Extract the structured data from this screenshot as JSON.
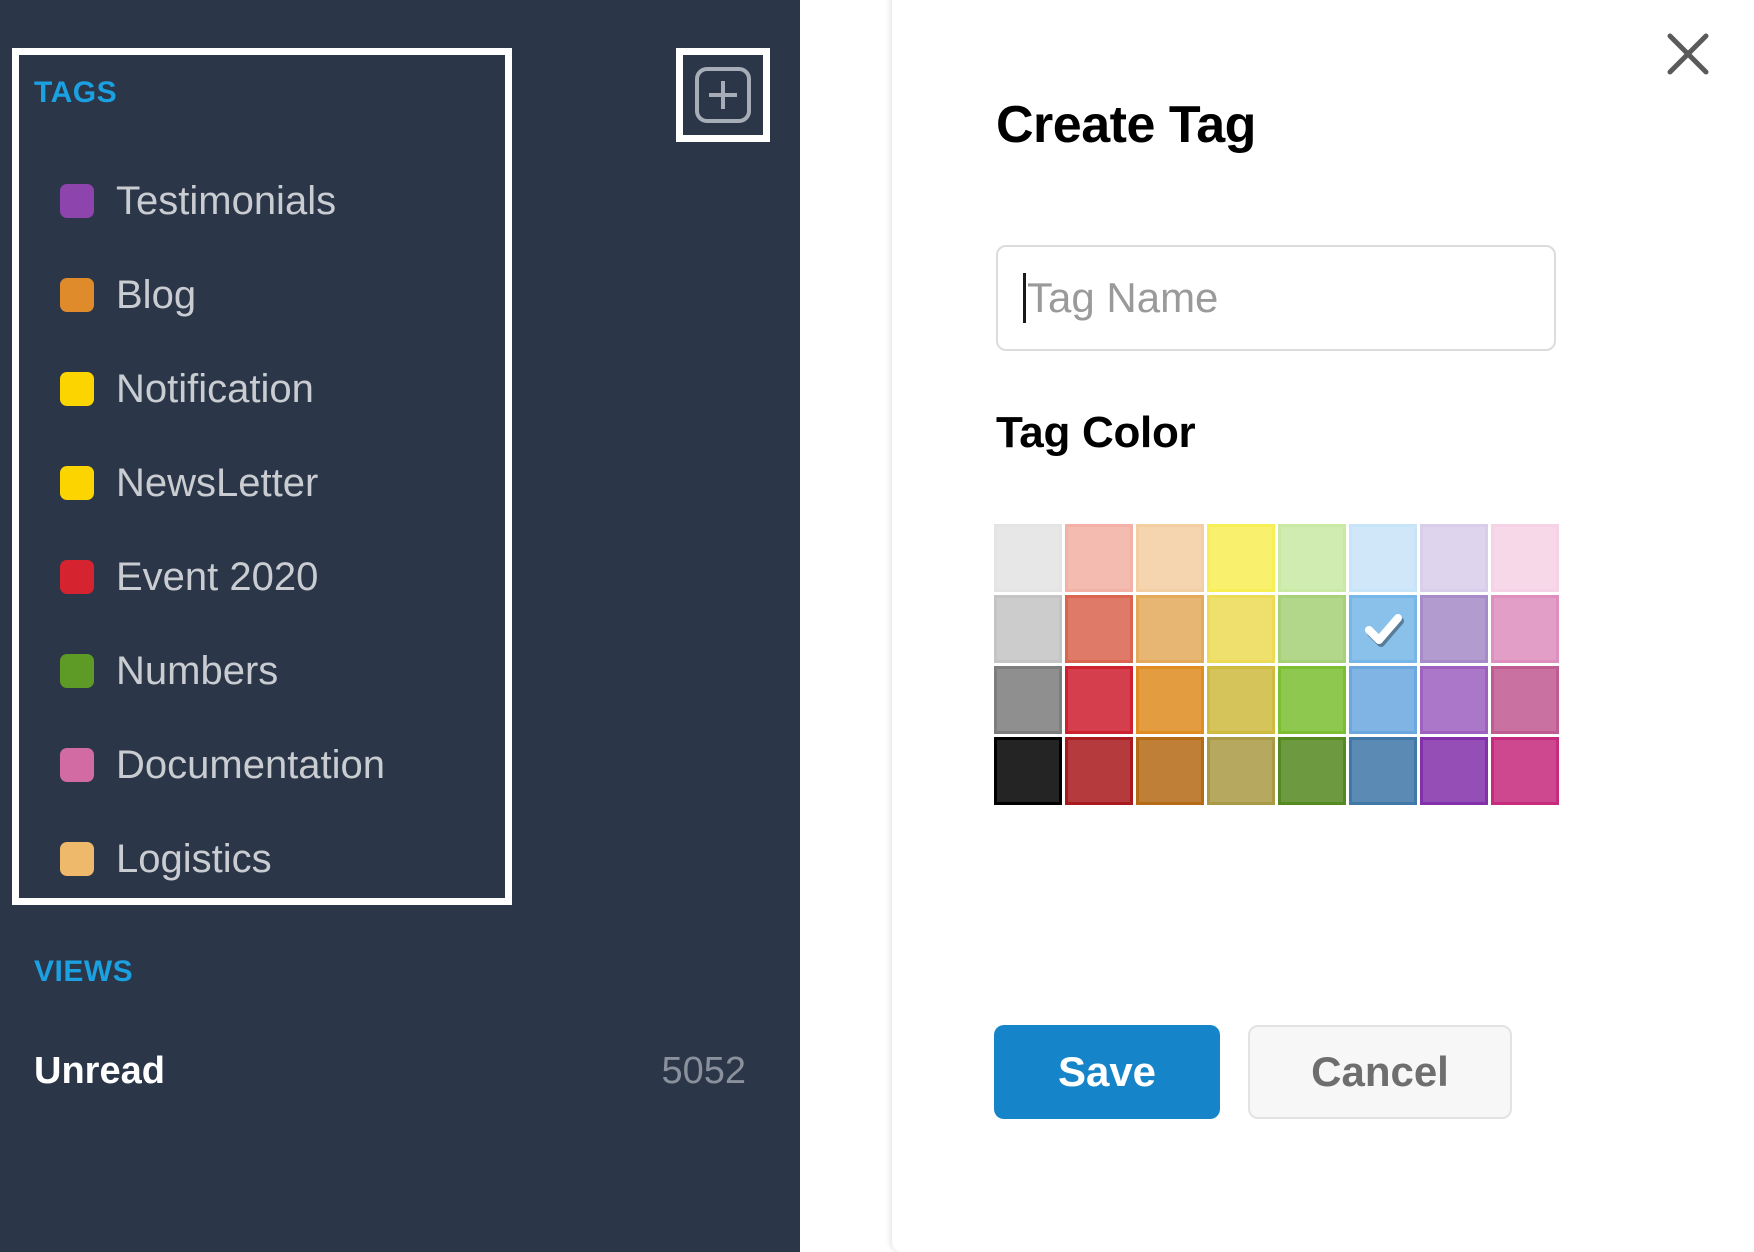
{
  "sidebar": {
    "tags_section": {
      "label": "TAGS",
      "add_button_icon": "plus-square-icon",
      "items": [
        {
          "label": "Testimonials",
          "color": "#8e44ad"
        },
        {
          "label": "Blog",
          "color": "#e08b2b"
        },
        {
          "label": "Notification",
          "color": "#fcd500"
        },
        {
          "label": "NewsLetter",
          "color": "#fcd500"
        },
        {
          "label": "Event 2020",
          "color": "#d52330"
        },
        {
          "label": "Numbers",
          "color": "#5d9b26"
        },
        {
          "label": "Documentation",
          "color": "#d26ba4"
        },
        {
          "label": "Logistics",
          "color": "#efb96b"
        }
      ]
    },
    "views_section": {
      "label": "VIEWS",
      "items": [
        {
          "name": "Unread",
          "count": "5052"
        }
      ]
    },
    "accent_color": "#1ba0e1",
    "background_color": "#2b3648"
  },
  "modal": {
    "title": "Create Tag",
    "close_icon": "close-icon",
    "tag_name": {
      "value": "",
      "placeholder": "Tag Name"
    },
    "color_label": "Tag Color",
    "selected_color": "#76b7e8",
    "selected_index": 13,
    "colors": [
      "#e4e4e4",
      "#f3b0a5",
      "#f3ceA2",
      "#f8ef55",
      "#c9e9a4",
      "#c7e4f8",
      "#d9cdec",
      "#f6d2e6",
      "#c4c4c4",
      "#da6551",
      "#e3aa5c",
      "#edda55",
      "#a6d178",
      "#76b7e8",
      "#a68bc8",
      "#de8fbd",
      "#7d7d7d",
      "#cf2030",
      "#e08c22",
      "#cfbb3e",
      "#7dbf33",
      "#6ba8e0",
      "#9e61c0",
      "#c05b92",
      "#000000",
      "#a91a1f",
      "#b56a16",
      "#ab9a45",
      "#558a21",
      "#4078a8",
      "#8331ab",
      "#c62b7e"
    ],
    "check_icon": "check-icon",
    "save_label": "Save",
    "cancel_label": "Cancel",
    "primary_color": "#1584c8"
  }
}
